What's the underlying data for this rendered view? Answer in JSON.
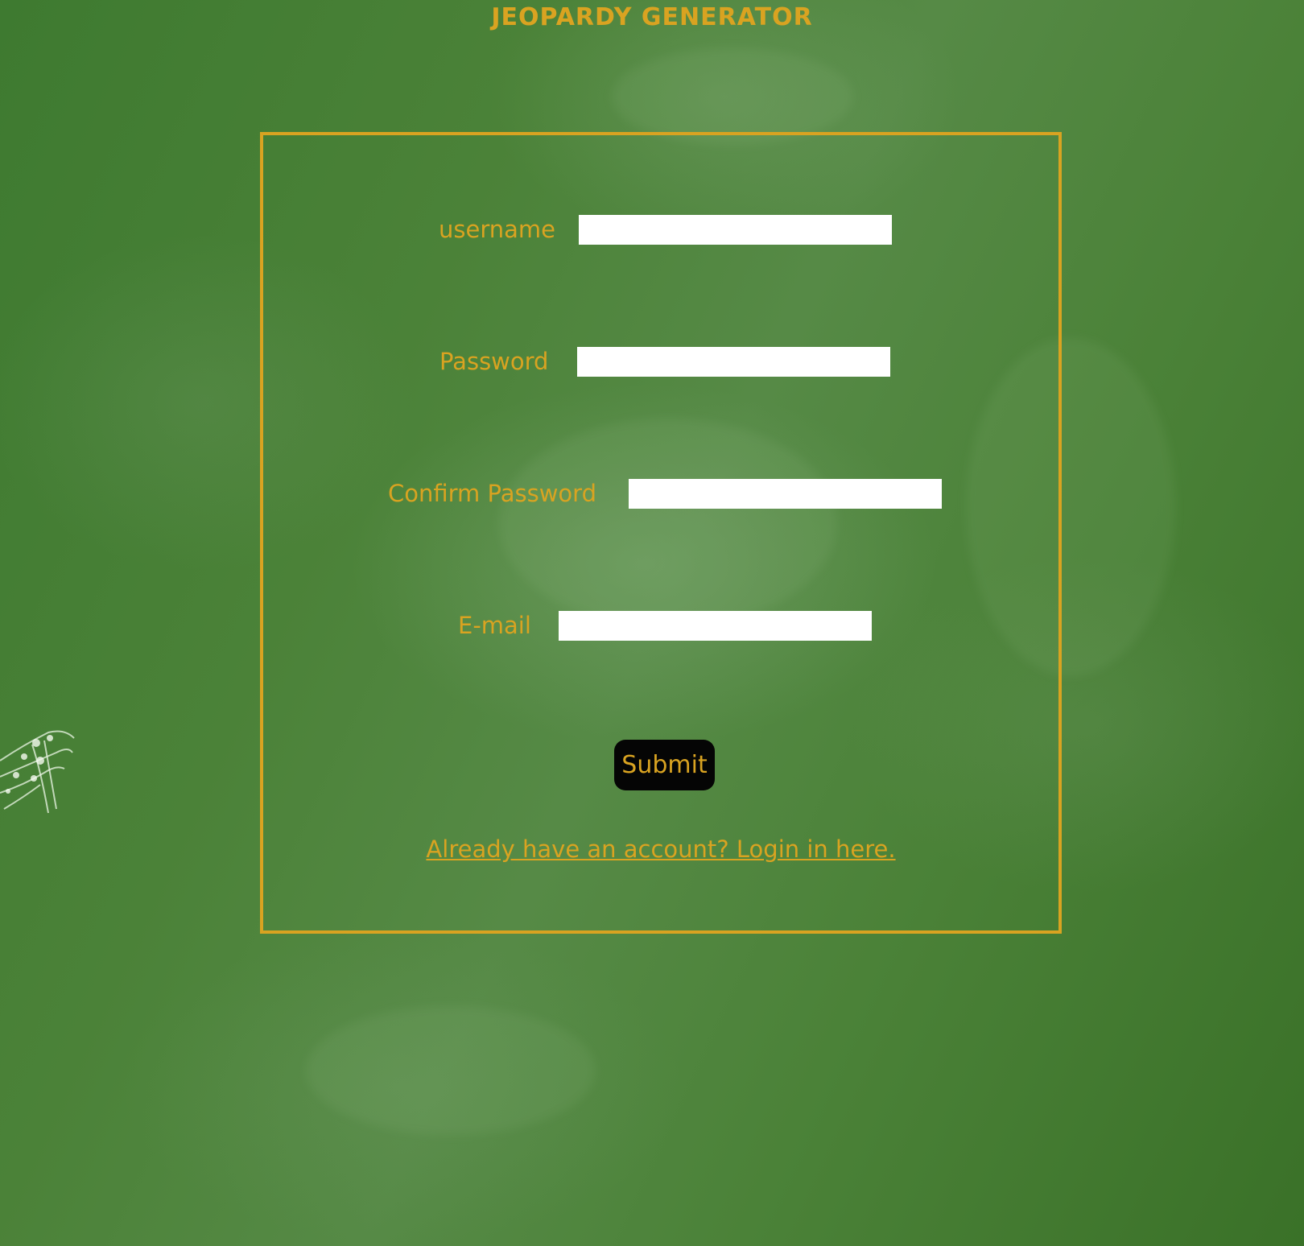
{
  "app": {
    "title": "JEOPARDY GENERATOR"
  },
  "form": {
    "username_label": "username",
    "password_label": "Password",
    "confirm_password_label": "Confirm Password",
    "email_label": "E-mail",
    "username_value": "",
    "password_value": "",
    "confirm_password_value": "",
    "email_value": "",
    "submit_label": "Submit",
    "login_link_text": "Already have an account? Login in here."
  },
  "colors": {
    "accent": "#d9a321",
    "background": "#4b8238",
    "button_background": "#050505",
    "input_background": "#ffffff"
  }
}
